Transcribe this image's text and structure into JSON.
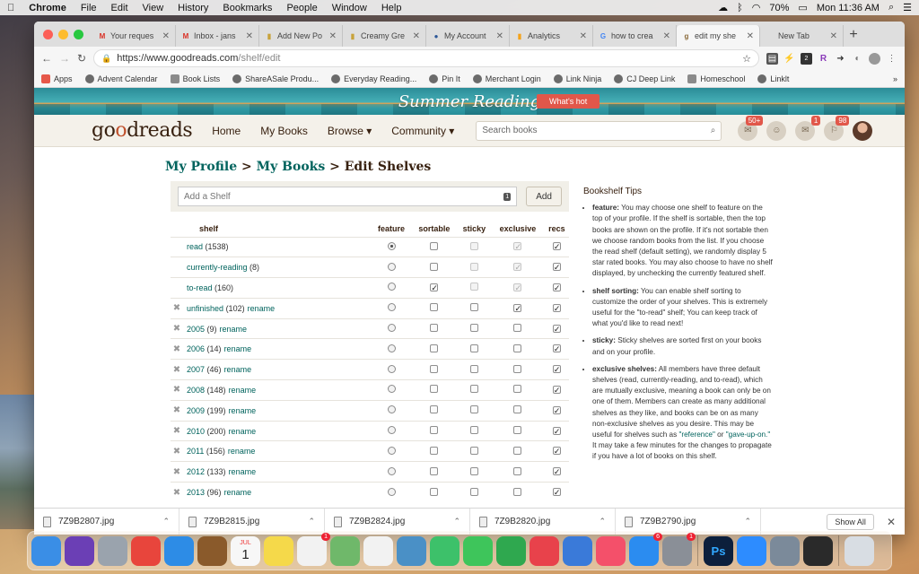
{
  "menubar": {
    "apple": "",
    "app": "Chrome",
    "items": [
      "File",
      "Edit",
      "View",
      "History",
      "Bookmarks",
      "People",
      "Window",
      "Help"
    ],
    "battery": "70%",
    "clock": "Mon 11:36 AM"
  },
  "tabs": [
    {
      "label": "Your reques",
      "icon": "gmail-icon",
      "glyph": "M",
      "color": "#d93025"
    },
    {
      "label": "Inbox - jans",
      "icon": "gmail-icon",
      "glyph": "M",
      "color": "#d93025"
    },
    {
      "label": "Add New Po",
      "icon": "fresh-icon",
      "glyph": "▮",
      "color": "#c8a23a"
    },
    {
      "label": "Creamy Gre",
      "icon": "fresh-icon",
      "glyph": "▮",
      "color": "#c8a23a"
    },
    {
      "label": "My Account",
      "icon": "globe-icon",
      "glyph": "●",
      "color": "#2b5797"
    },
    {
      "label": "Analytics",
      "icon": "analytics-icon",
      "glyph": "▮",
      "color": "#f4a21a"
    },
    {
      "label": "how to crea",
      "icon": "google-icon",
      "glyph": "G",
      "color": "#4285f4"
    },
    {
      "label": "edit my she",
      "icon": "goodreads-icon",
      "glyph": "g",
      "color": "#8a6a3a",
      "active": true
    },
    {
      "label": "New Tab",
      "icon": "",
      "glyph": "",
      "color": "#666"
    }
  ],
  "toolbar": {
    "url_prefix": "https://www.goodreads.com",
    "url_path": "/shelf/edit",
    "back": "←",
    "forward": "→",
    "reload": "↻",
    "star": "☆",
    "ext_badge": "2",
    "menu": "⋮"
  },
  "bookmarks": [
    {
      "label": "Apps",
      "icon": "apps-grid-icon"
    },
    {
      "label": "Advent Calendar",
      "icon": "globe-icon"
    },
    {
      "label": "Book Lists",
      "icon": "folder-icon"
    },
    {
      "label": "ShareASale Produ...",
      "icon": "globe-icon"
    },
    {
      "label": "Everyday Reading...",
      "icon": "fresh-icon"
    },
    {
      "label": "Pin It",
      "icon": "globe-icon"
    },
    {
      "label": "Merchant Login",
      "icon": "star-icon"
    },
    {
      "label": "Link Ninja",
      "icon": "globe-icon"
    },
    {
      "label": "CJ Deep Link",
      "icon": "globe-icon"
    },
    {
      "label": "Homeschool",
      "icon": "folder-icon"
    },
    {
      "label": "Linklt",
      "icon": "globe-icon"
    }
  ],
  "banner": {
    "title": "Summer Reading",
    "cta": "What's hot"
  },
  "header": {
    "logo_a": "go",
    "logo_o": "o",
    "logo_b": "dreads",
    "nav": [
      "Home",
      "My Books",
      "Browse ▾",
      "Community ▾"
    ],
    "search_placeholder": "Search books",
    "badges": {
      "notifications": "50+",
      "friends": "",
      "messages": "1",
      "updates": "98"
    }
  },
  "breadcrumb": {
    "profile": "My Profile",
    "sep": " > ",
    "books": "My Books",
    "current": "Edit Shelves"
  },
  "add_shelf": {
    "placeholder": "Add a Shelf",
    "button": "Add",
    "badge": "1"
  },
  "columns": {
    "shelf": "shelf",
    "feature": "feature",
    "sortable": "sortable",
    "sticky": "sticky",
    "exclusive": "exclusive",
    "recs": "recs"
  },
  "shelves": [
    {
      "name": "read",
      "count": "(1538)",
      "rename": "",
      "del": false,
      "feature": true,
      "sortable": false,
      "sticky": false,
      "exclusive": true,
      "recs": true,
      "fixed": true
    },
    {
      "name": "currently-reading",
      "count": "(8)",
      "rename": "",
      "del": false,
      "feature": false,
      "sortable": false,
      "sticky": false,
      "exclusive": true,
      "recs": true,
      "fixed": true
    },
    {
      "name": "to-read",
      "count": "(160)",
      "rename": "",
      "del": false,
      "feature": false,
      "sortable": true,
      "sticky": false,
      "exclusive": true,
      "recs": true,
      "fixed": true
    },
    {
      "name": "unfinished",
      "count": "(102)",
      "rename": "rename",
      "del": true,
      "feature": false,
      "sortable": false,
      "sticky": false,
      "exclusive": true,
      "recs": true,
      "fixed": false
    },
    {
      "name": "2005",
      "count": "(9)",
      "rename": "rename",
      "del": true,
      "feature": false,
      "sortable": false,
      "sticky": false,
      "exclusive": false,
      "recs": true,
      "fixed": false
    },
    {
      "name": "2006",
      "count": "(14)",
      "rename": "rename",
      "del": true,
      "feature": false,
      "sortable": false,
      "sticky": false,
      "exclusive": false,
      "recs": true,
      "fixed": false
    },
    {
      "name": "2007",
      "count": "(46)",
      "rename": "rename",
      "del": true,
      "feature": false,
      "sortable": false,
      "sticky": false,
      "exclusive": false,
      "recs": true,
      "fixed": false
    },
    {
      "name": "2008",
      "count": "(148)",
      "rename": "rename",
      "del": true,
      "feature": false,
      "sortable": false,
      "sticky": false,
      "exclusive": false,
      "recs": true,
      "fixed": false
    },
    {
      "name": "2009",
      "count": "(199)",
      "rename": "rename",
      "del": true,
      "feature": false,
      "sortable": false,
      "sticky": false,
      "exclusive": false,
      "recs": true,
      "fixed": false
    },
    {
      "name": "2010",
      "count": "(200)",
      "rename": "rename",
      "del": true,
      "feature": false,
      "sortable": false,
      "sticky": false,
      "exclusive": false,
      "recs": true,
      "fixed": false
    },
    {
      "name": "2011",
      "count": "(156)",
      "rename": "rename",
      "del": true,
      "feature": false,
      "sortable": false,
      "sticky": false,
      "exclusive": false,
      "recs": true,
      "fixed": false
    },
    {
      "name": "2012",
      "count": "(133)",
      "rename": "rename",
      "del": true,
      "feature": false,
      "sortable": false,
      "sticky": false,
      "exclusive": false,
      "recs": true,
      "fixed": false
    },
    {
      "name": "2013",
      "count": "(96)",
      "rename": "rename",
      "del": true,
      "feature": false,
      "sortable": false,
      "sticky": false,
      "exclusive": false,
      "recs": true,
      "fixed": false
    }
  ],
  "tips": {
    "title": "Bookshelf Tips",
    "items": [
      {
        "term": "feature:",
        "text": " You may choose one shelf to feature on the top of your profile. If the shelf is sortable, then the top books are shown on the profile. If it's not sortable then we choose random books from the list. If you choose the read shelf (default setting), we randomly display 5 star rated books. You may also choose to have no shelf displayed, by unchecking the currently featured shelf."
      },
      {
        "term": "shelf sorting:",
        "text": " You can enable shelf sorting to customize the order of your shelves. This is extremely useful for the \"to-read\" shelf; You can keep track of what you'd like to read next!"
      },
      {
        "term": "sticky:",
        "text": " Sticky shelves are sorted first on your books and on your profile."
      },
      {
        "term": "exclusive shelves:",
        "text": " All members have three default shelves (read, currently-reading, and to-read), which are mutually exclusive, meaning a book can only be on one of them. Members can create as many additional shelves as they like, and books can be on as many non-exclusive shelves as you desire. This may be useful for shelves such as ",
        "q1": "\"reference\"",
        "mid": " or ",
        "q2": "\"gave-up-on.\"",
        "end": " It may take a few minutes for the changes to propagate if you have a lot of books on this shelf."
      }
    ]
  },
  "downloads": {
    "files": [
      "7Z9B2807.jpg",
      "7Z9B2815.jpg",
      "7Z9B2824.jpg",
      "7Z9B2820.jpg",
      "7Z9B2790.jpg"
    ],
    "show_all": "Show All",
    "close": "✕"
  },
  "dock": {
    "apps": [
      {
        "name": "finder-icon",
        "color": "#3a8ee6"
      },
      {
        "name": "siri-icon",
        "color": "#6b3fb5"
      },
      {
        "name": "launchpad-icon",
        "color": "#9aa3ad"
      },
      {
        "name": "chrome-icon",
        "color": "#e8453c"
      },
      {
        "name": "safari-icon",
        "color": "#2d8ce6"
      },
      {
        "name": "notebook-icon",
        "color": "#8a5a2b"
      },
      {
        "name": "calendar-icon",
        "color": "#f7f7f7",
        "badge": ""
      },
      {
        "name": "notes-icon",
        "color": "#f5d94a"
      },
      {
        "name": "reminders-icon",
        "color": "#f2f2f2",
        "badge": "1"
      },
      {
        "name": "maps-icon",
        "color": "#6fb86a"
      },
      {
        "name": "photos-icon",
        "color": "#f2f2f2"
      },
      {
        "name": "preview-icon",
        "color": "#4a90c6"
      },
      {
        "name": "messages-icon",
        "color": "#3dc16a"
      },
      {
        "name": "facetime-icon",
        "color": "#3ec55b"
      },
      {
        "name": "numbers-icon",
        "color": "#2fa84f"
      },
      {
        "name": "news-icon",
        "color": "#e8424b"
      },
      {
        "name": "keynote-icon",
        "color": "#3a7ad9"
      },
      {
        "name": "music-icon",
        "color": "#f4506a"
      },
      {
        "name": "app-store-icon",
        "color": "#2b8cf0",
        "badge": "6"
      },
      {
        "name": "system-preferences-icon",
        "color": "#8a8f97",
        "badge": "1"
      },
      {
        "name": "photoshop-icon",
        "color": "#0c1f3c"
      },
      {
        "name": "zoom-icon",
        "color": "#2d8cff"
      },
      {
        "name": "screenshot-icon",
        "color": "#7b8a9a"
      },
      {
        "name": "quicktime-icon",
        "color": "#2a2a2a"
      },
      {
        "name": "trash-icon",
        "color": "#d8dde3"
      }
    ],
    "calendar_month": "JUL",
    "calendar_day": "1"
  }
}
